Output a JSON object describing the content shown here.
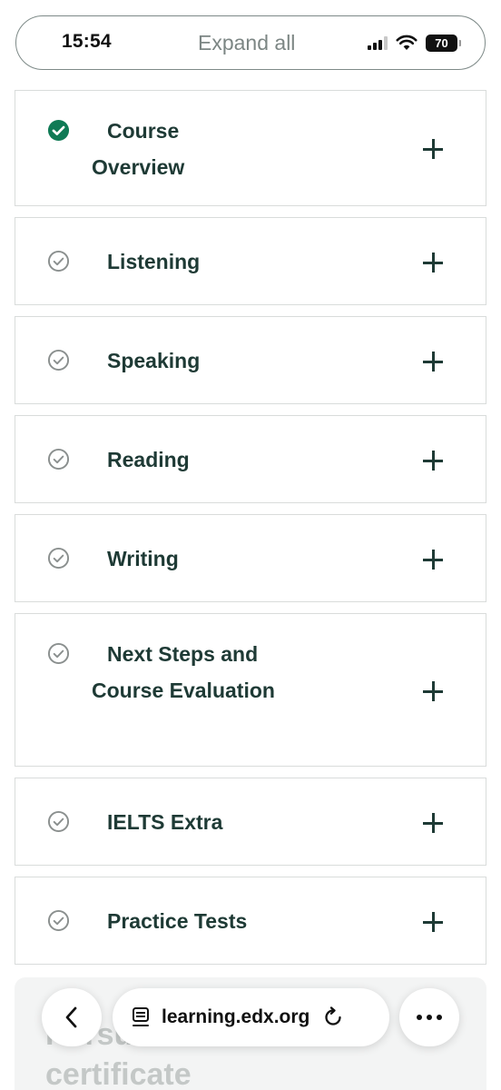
{
  "status_bar": {
    "time": "15:54",
    "expand_all_label": "Expand all",
    "battery_level": "70",
    "signal_bars": 3,
    "icons": [
      "signal-icon",
      "wifi-icon",
      "battery-icon"
    ]
  },
  "sections": [
    {
      "title": "Course Overview",
      "completed": true
    },
    {
      "title": "Listening",
      "completed": false
    },
    {
      "title": "Speaking",
      "completed": false
    },
    {
      "title": "Reading",
      "completed": false
    },
    {
      "title": "Writing",
      "completed": false
    },
    {
      "title": "Next Steps and Course Evaluation",
      "completed": false
    },
    {
      "title": "IELTS Extra",
      "completed": false
    },
    {
      "title": "Practice Tests",
      "completed": false
    }
  ],
  "certificate_card": {
    "heading": "Pursue a verified",
    "text": "certificate"
  },
  "browser_toolbar": {
    "url": "learning.edx.org",
    "icons": [
      "back-arrow-icon",
      "page-icon",
      "reload-icon",
      "more-icon"
    ]
  },
  "colors": {
    "completed_check": "#0f7a55",
    "pending_check": "#8a8f8e",
    "title_text": "#1e3a35",
    "row_border": "#d9dcdb"
  }
}
